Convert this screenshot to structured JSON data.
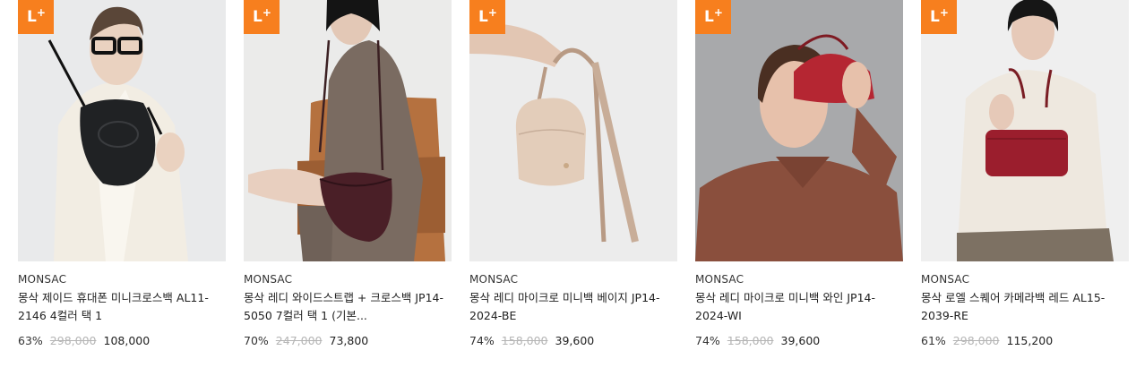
{
  "badge": {
    "label": "L",
    "suffix": "+",
    "color": "#f77f1e"
  },
  "products": [
    {
      "brand": "MONSAC",
      "title": "몽삭 제이드 휴대폰 미니크로스백 AL11-2146 4컬러 택 1",
      "discount": "63%",
      "original_price": "298,000",
      "sale_price": "108,000",
      "image": "woman-glasses-white-blazer-black-bag"
    },
    {
      "brand": "MONSAC",
      "title": "몽삭 레디 와이드스트랩 + 크로스백 JP14-5050 7컬러 택 1 (기본...",
      "discount": "70%",
      "original_price": "247,000",
      "sale_price": "73,800",
      "image": "woman-brown-dress-chair-burgundy-bag"
    },
    {
      "brand": "MONSAC",
      "title": "몽삭 레디 마이크로 미니백 베이지 JP14-2024-BE",
      "discount": "74%",
      "original_price": "158,000",
      "sale_price": "39,600",
      "image": "hand-holding-beige-mini-bag"
    },
    {
      "brand": "MONSAC",
      "title": "몽삭 레디 마이크로 미니백 와인 JP14-2024-WI",
      "discount": "74%",
      "original_price": "158,000",
      "sale_price": "39,600",
      "image": "woman-brown-shirt-red-bag"
    },
    {
      "brand": "MONSAC",
      "title": "몽삭 로엘 스퀘어 카메라백 레드 AL15-2039-RE",
      "discount": "61%",
      "original_price": "298,000",
      "sale_price": "115,200",
      "image": "woman-cream-sweater-red-camera-bag"
    }
  ]
}
